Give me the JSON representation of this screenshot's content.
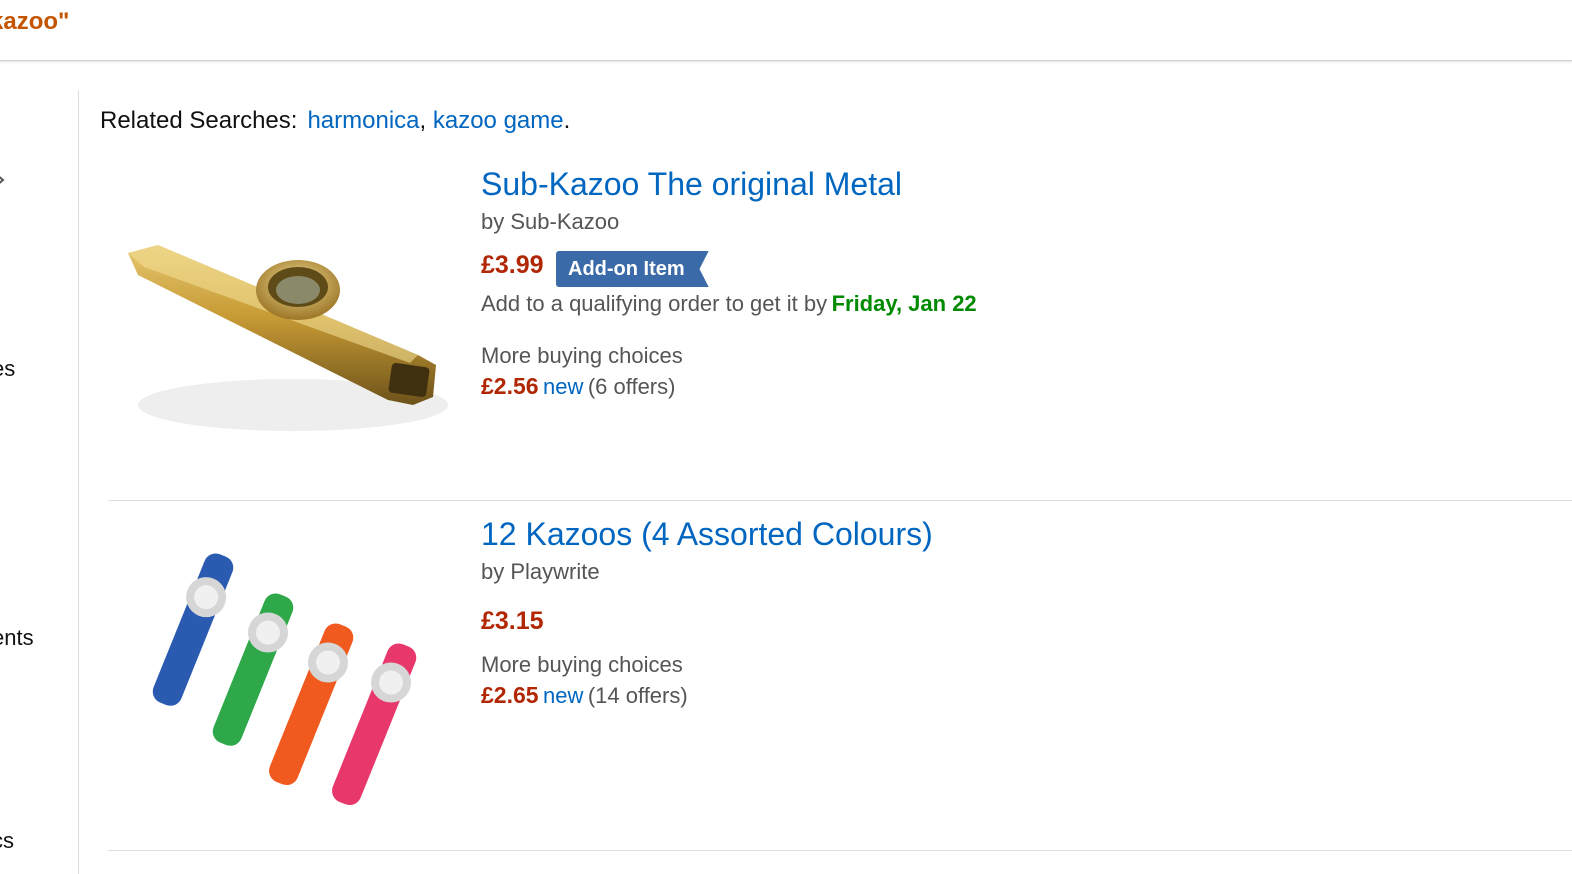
{
  "header": {
    "query_fragment": "kazoo\""
  },
  "sidebar": {
    "fragments": [
      "es",
      "ents",
      "cs"
    ]
  },
  "related": {
    "label": "Related Searches:",
    "links": [
      "harmonica",
      "kazoo game"
    ],
    "separator": ",",
    "terminator": "."
  },
  "results": [
    {
      "title": "Sub-Kazoo The original Metal",
      "byline": "by Sub-Kazoo",
      "price": "£3.99",
      "badge": "Add-on Item",
      "delivery_prefix": "Add to a qualifying order to get it by",
      "delivery_date": "Friday, Jan 22",
      "more_choices_label": "More buying choices",
      "offer_price": "£2.56",
      "offer_condition": "new",
      "offer_count": "(6 offers)",
      "image": "gold-metal-kazoo"
    },
    {
      "title": "12 Kazoos (4 Assorted Colours)",
      "byline": "by Playwrite",
      "price": "£3.15",
      "more_choices_label": "More buying choices",
      "offer_price": "£2.65",
      "offer_condition": "new",
      "offer_count": "(14 offers)",
      "image": "four-colour-plastic-kazoos"
    }
  ],
  "colors": {
    "link": "#0066c0",
    "price": "#b12704",
    "badge": "#3a6aa7",
    "delivery": "#008a00",
    "query": "#c45500"
  }
}
